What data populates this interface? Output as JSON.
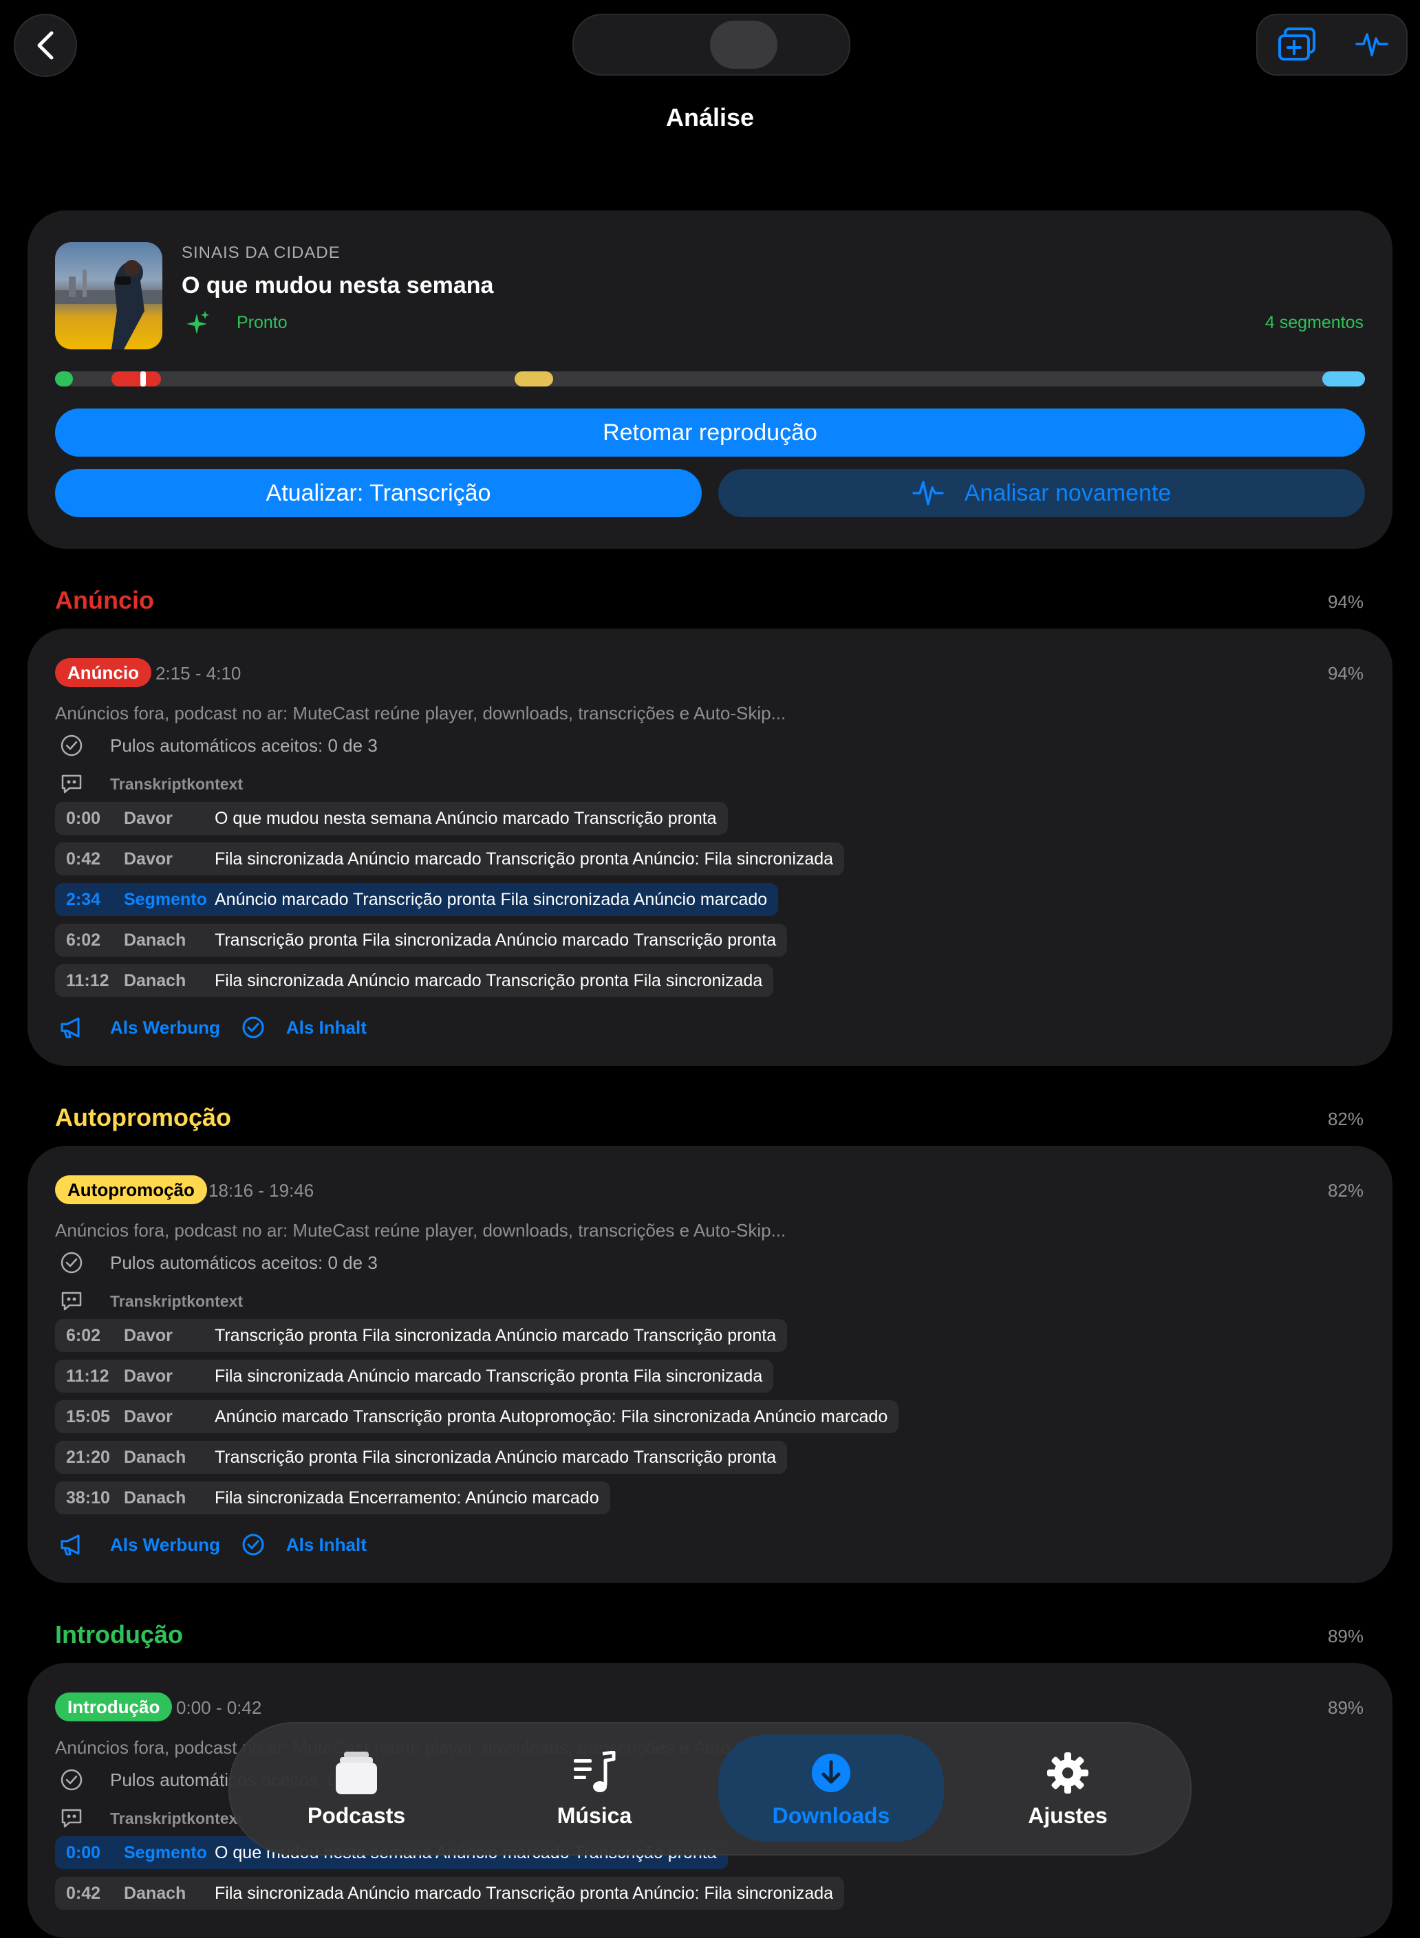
{
  "header": {
    "title": "Análise"
  },
  "podcast": {
    "show": "SINAIS DA CIDADE",
    "episode": "O que mudou nesta semana",
    "status": "Pronto",
    "segments_count": "4 segmentos",
    "resume_label": "Retomar reprodução",
    "update_label": "Atualizar: Transcrição",
    "reanalyze_label": "Analisar novamente"
  },
  "colors": {
    "ad": "#e0302a",
    "promo": "#ffd84d",
    "intro": "#30c25a",
    "accent": "#0a84ff",
    "outro": "#5ac8fa"
  },
  "sections": [
    {
      "title": "Anúncio",
      "pct": "94%",
      "badge": "Anúncio",
      "range": "2:15 - 4:10",
      "card_pct": "94%",
      "desc": "Anúncios fora, podcast no ar: MuteCast reúne player, downloads, transcrições e Auto-Skip...",
      "accepted": "Pulos automáticos aceitos: 0 de 3",
      "context_label": "Transkriptkontext",
      "rows": [
        {
          "time": "0:00",
          "who": "Davor",
          "text": "O que mudou nesta semana Anúncio marcado Transcrição pronta"
        },
        {
          "time": "0:42",
          "who": "Davor",
          "text": "Fila sincronizada Anúncio marcado Transcrição pronta Anúncio: Fila sincronizada"
        },
        {
          "time": "2:34",
          "who": "Segmento",
          "text": "Anúncio marcado Transcrição pronta Fila sincronizada Anúncio marcado"
        },
        {
          "time": "6:02",
          "who": "Danach",
          "text": "Transcrição pronta Fila sincronizada Anúncio marcado Transcrição pronta"
        },
        {
          "time": "11:12",
          "who": "Danach",
          "text": "Fila sincronizada Anúncio marcado Transcrição pronta Fila sincronizada"
        }
      ],
      "as_ad": "Als Werbung",
      "as_content": "Als Inhalt"
    },
    {
      "title": "Autopromoção",
      "pct": "82%",
      "badge": "Autopromoção",
      "range": "18:16 - 19:46",
      "card_pct": "82%",
      "desc": "Anúncios fora, podcast no ar: MuteCast reúne player, downloads, transcrições e Auto-Skip...",
      "accepted": "Pulos automáticos aceitos: 0 de 3",
      "context_label": "Transkriptkontext",
      "rows": [
        {
          "time": "6:02",
          "who": "Davor",
          "text": "Transcrição pronta Fila sincronizada Anúncio marcado Transcrição pronta"
        },
        {
          "time": "11:12",
          "who": "Davor",
          "text": "Fila sincronizada Anúncio marcado Transcrição pronta Fila sincronizada"
        },
        {
          "time": "15:05",
          "who": "Davor",
          "text": "Anúncio marcado Transcrição pronta Autopromoção: Fila sincronizada Anúncio marcado"
        },
        {
          "time": "21:20",
          "who": "Danach",
          "text": "Transcrição pronta Fila sincronizada Anúncio marcado Transcrição pronta"
        },
        {
          "time": "38:10",
          "who": "Danach",
          "text": "Fila sincronizada Encerramento: Anúncio marcado"
        }
      ],
      "as_ad": "Als Werbung",
      "as_content": "Als Inhalt"
    },
    {
      "title": "Introdução",
      "pct": "89%",
      "badge": "Introdução",
      "range": "0:00 - 0:42",
      "card_pct": "89%",
      "desc": "Anúncios fora, podcast no ar: MuteCast reúne player, downloads, transcrições e Auto-Skip...",
      "accepted": "Pulos automáticos aceitos: 0 de 3",
      "context_label": "Transkriptkontext",
      "rows": [
        {
          "time": "0:00",
          "who": "Segmento",
          "text": "O que mudou nesta semana Anúncio marcado Transcrição pronta"
        },
        {
          "time": "0:42",
          "who": "Danach",
          "text": "Fila sincronizada Anúncio marcado Transcrição pronta Anúncio: Fila sincronizada"
        }
      ]
    }
  ],
  "tabs": [
    {
      "label": "Podcasts",
      "icon": "stack-icon"
    },
    {
      "label": "Música",
      "icon": "music-note-icon"
    },
    {
      "label": "Downloads",
      "icon": "download-icon"
    },
    {
      "label": "Ajustes",
      "icon": "gear-icon"
    }
  ]
}
